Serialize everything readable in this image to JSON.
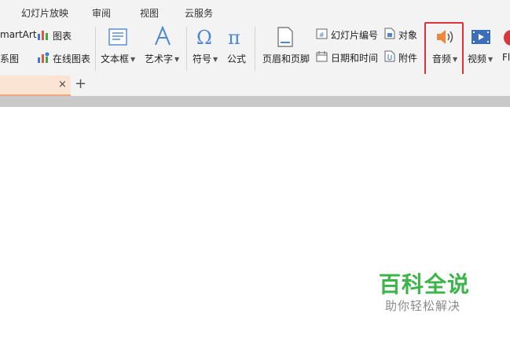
{
  "menu": {
    "tabs": [
      "幻灯片放映",
      "审阅",
      "视图",
      "云服务"
    ]
  },
  "ribbon": {
    "smartart_label": "martArt",
    "chart_label": "图表",
    "relation_label": "系图",
    "online_chart_label": "在线图表",
    "textbox_label": "文本框",
    "arttext_label": "艺术字",
    "symbol_label": "符号",
    "formula_label": "公式",
    "header_footer_label": "页眉和页脚",
    "slide_number_label": "幻灯片编号",
    "object_label": "对象",
    "datetime_label": "日期和时间",
    "attachment_label": "附件",
    "audio_label": "音频",
    "video_label": "视频",
    "flash_label": "Fl"
  },
  "document_tabs": {
    "close_symbol": "×",
    "new_tab_symbol": "+"
  },
  "watermark": {
    "title": "百科全说",
    "subtitle": "助你轻松解决"
  },
  "colors": {
    "highlight": "#d9353d",
    "active_tab": "#fbe4d3",
    "watermark_green": "#3cb44a",
    "audio_orange": "#f0883a"
  }
}
